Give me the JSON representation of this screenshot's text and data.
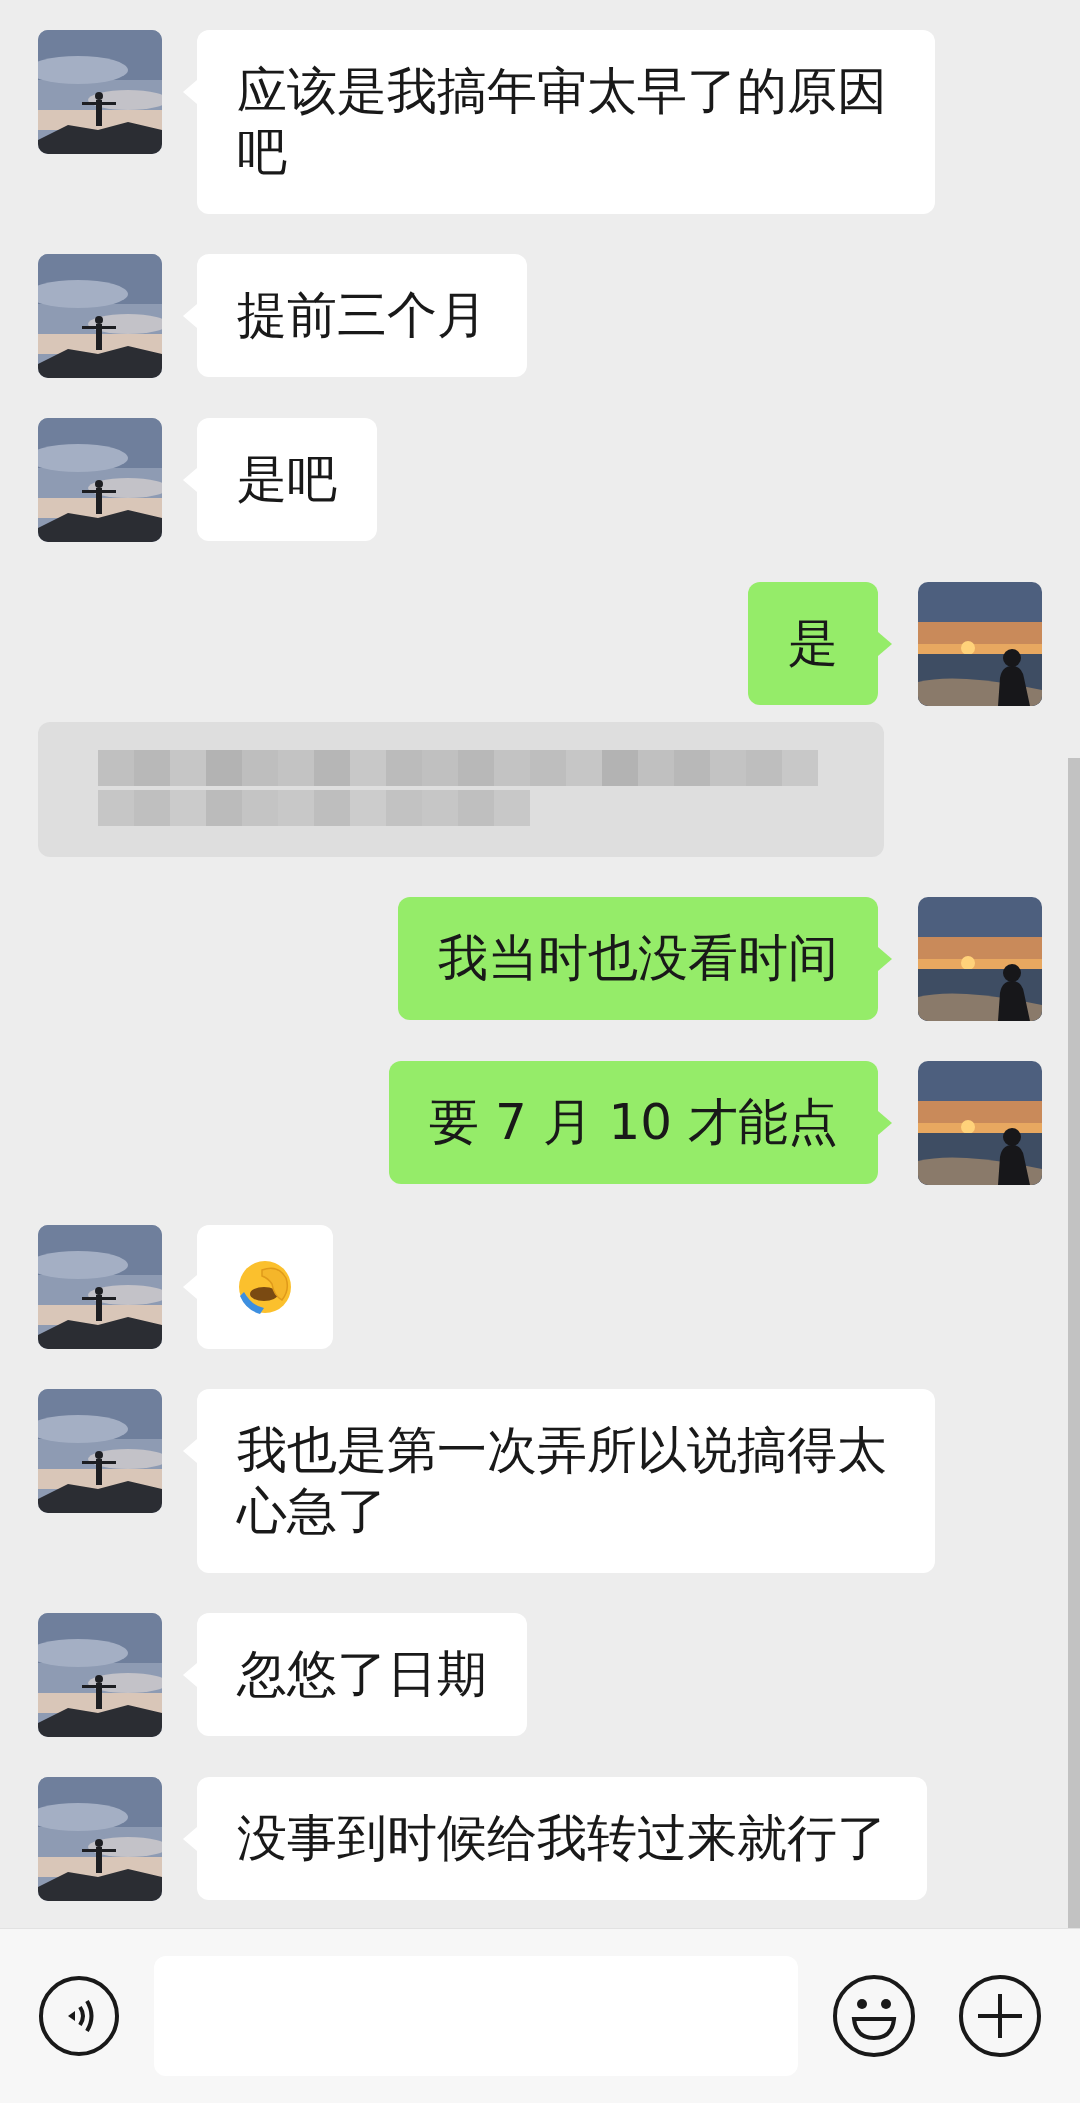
{
  "messages": [
    {
      "kind": "text",
      "outgoing": false,
      "text": "应该是我搞年审太早了的原因吧"
    },
    {
      "kind": "text",
      "outgoing": false,
      "text": "提前三个月"
    },
    {
      "kind": "text",
      "outgoing": false,
      "text": "是吧"
    },
    {
      "kind": "text",
      "outgoing": true,
      "text": "是"
    },
    {
      "kind": "redacted_quote"
    },
    {
      "kind": "text",
      "outgoing": true,
      "text": "我当时也没看时间"
    },
    {
      "kind": "text",
      "outgoing": true,
      "text": "要 7 月 10 才能点"
    },
    {
      "kind": "emoji",
      "outgoing": false
    },
    {
      "kind": "text",
      "outgoing": false,
      "text": "我也是第一次弄所以说搞得太心急了"
    },
    {
      "kind": "text",
      "outgoing": false,
      "text": "忽悠了日期"
    },
    {
      "kind": "text",
      "outgoing": false,
      "text": "没事到时候给我转过来就行了"
    }
  ]
}
